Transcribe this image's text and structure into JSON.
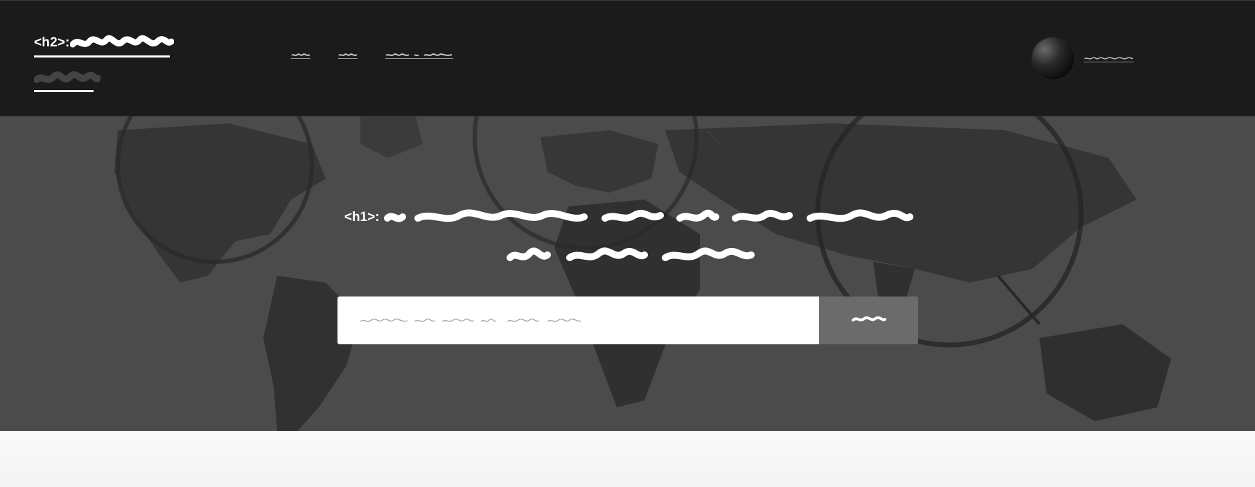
{
  "header": {
    "brand_tag": "<h2>:",
    "nav": [
      {
        "label": ""
      },
      {
        "label": ""
      },
      {
        "label": ""
      }
    ],
    "user_name": ""
  },
  "hero": {
    "title_tag": "<h1>:",
    "search": {
      "placeholder": "",
      "value": "",
      "button_label": ""
    }
  },
  "colors": {
    "topbar": "#1b1b1b",
    "hero_overlay": "#4a4a4a",
    "search_button": "#6b6b6b",
    "page_background": "#f8f8f8"
  },
  "icons": [
    "avatar-image"
  ]
}
